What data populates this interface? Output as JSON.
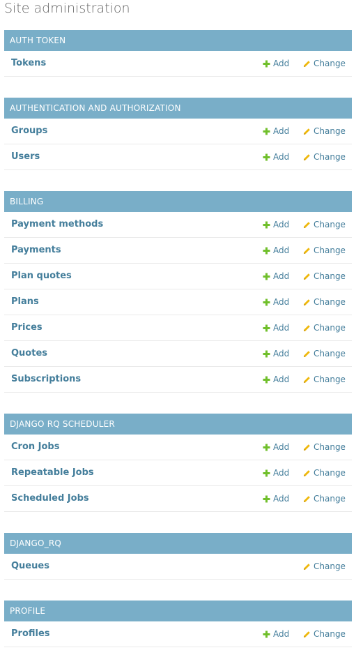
{
  "page": {
    "title": "Site administration"
  },
  "actions": {
    "add_label": "Add",
    "change_label": "Change"
  },
  "colors": {
    "caption_bg": "#79aec8",
    "link": "#447e9b",
    "add_icon": "#70bf2b",
    "change_icon": "#efb80b"
  },
  "icons": {
    "add": "plus-icon",
    "change": "pencil-icon"
  },
  "modules": [
    {
      "caption": "Auth Token",
      "rows": [
        {
          "name": "Tokens",
          "can_add": true
        }
      ]
    },
    {
      "caption": "Authentication and Authorization",
      "rows": [
        {
          "name": "Groups",
          "can_add": true
        },
        {
          "name": "Users",
          "can_add": true
        }
      ]
    },
    {
      "caption": "Billing",
      "rows": [
        {
          "name": "Payment methods",
          "can_add": true
        },
        {
          "name": "Payments",
          "can_add": true
        },
        {
          "name": "Plan quotes",
          "can_add": true
        },
        {
          "name": "Plans",
          "can_add": true
        },
        {
          "name": "Prices",
          "can_add": true
        },
        {
          "name": "Quotes",
          "can_add": true
        },
        {
          "name": "Subscriptions",
          "can_add": true
        }
      ]
    },
    {
      "caption": "Django RQ Scheduler",
      "rows": [
        {
          "name": "Cron Jobs",
          "can_add": true
        },
        {
          "name": "Repeatable Jobs",
          "can_add": true
        },
        {
          "name": "Scheduled Jobs",
          "can_add": true
        }
      ]
    },
    {
      "caption": "Django_RQ",
      "rows": [
        {
          "name": "Queues",
          "can_add": false
        }
      ]
    },
    {
      "caption": "Profile",
      "rows": [
        {
          "name": "Profiles",
          "can_add": true
        }
      ]
    }
  ]
}
